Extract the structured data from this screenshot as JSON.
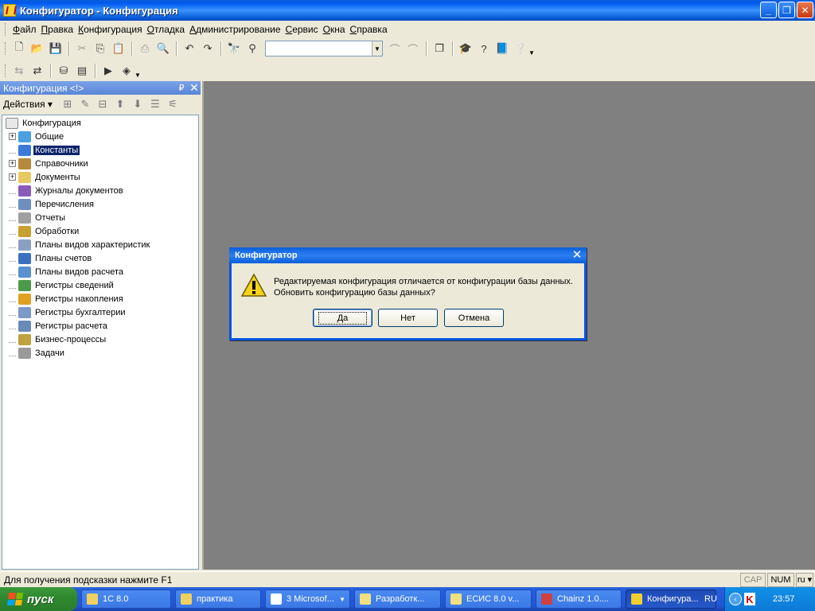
{
  "window": {
    "title": "Конфигуратор - Конфигурация",
    "min": "_",
    "restore": "❐",
    "close": "✕"
  },
  "menu": [
    {
      "u": "Ф",
      "rest": "айл"
    },
    {
      "u": "П",
      "rest": "равка"
    },
    {
      "u": "К",
      "rest": "онфигурация"
    },
    {
      "u": "О",
      "rest": "тладка"
    },
    {
      "u": "А",
      "rest": "дминистрирование"
    },
    {
      "u": "С",
      "rest": "ервис"
    },
    {
      "u": "О",
      "rest": "кна"
    },
    {
      "u": "С",
      "rest": "правка"
    }
  ],
  "search": {
    "value": ""
  },
  "panel": {
    "title": "Конфигурация <!>",
    "pin": "₽",
    "close": "✕",
    "actions": "Действия ▾",
    "tree": {
      "root": "Конфигурация",
      "items": [
        {
          "label": "Общие",
          "expander": "+",
          "color": "#4aa0e0"
        },
        {
          "label": "Константы",
          "expander": "",
          "color": "#3a7ad8",
          "selected": true
        },
        {
          "label": "Справочники",
          "expander": "+",
          "color": "#b58a3c"
        },
        {
          "label": "Документы",
          "expander": "+",
          "color": "#e8c860"
        },
        {
          "label": "Журналы документов",
          "expander": "",
          "color": "#8a5ab8"
        },
        {
          "label": "Перечисления",
          "expander": "",
          "color": "#6f8fc0"
        },
        {
          "label": "Отчеты",
          "expander": "",
          "color": "#a0a0a0"
        },
        {
          "label": "Обработки",
          "expander": "",
          "color": "#c8a030"
        },
        {
          "label": "Планы видов характеристик",
          "expander": "",
          "color": "#8aa0c0"
        },
        {
          "label": "Планы счетов",
          "expander": "",
          "color": "#3a70c0"
        },
        {
          "label": "Планы видов расчета",
          "expander": "",
          "color": "#5a90d0"
        },
        {
          "label": "Регистры сведений",
          "expander": "",
          "color": "#4a9a4a"
        },
        {
          "label": "Регистры накопления",
          "expander": "",
          "color": "#e0a020"
        },
        {
          "label": "Регистры бухгалтерии",
          "expander": "",
          "color": "#7a9ac8"
        },
        {
          "label": "Регистры расчета",
          "expander": "",
          "color": "#6a8ab8"
        },
        {
          "label": "Бизнес-процессы",
          "expander": "",
          "color": "#c0a040"
        },
        {
          "label": "Задачи",
          "expander": "",
          "color": "#9a9a9a"
        }
      ]
    }
  },
  "dialog": {
    "title": "Конфигуратор",
    "close": "✕",
    "message_line1": "Редактируемая конфигурация отличается от конфигурации базы данных.",
    "message_line2": "Обновить конфигурацию базы данных?",
    "yes": "Да",
    "no": "Нет",
    "cancel": "Отмена"
  },
  "status": {
    "hint": "Для получения подсказки нажмите F1",
    "cap": "CAP",
    "num": "NUM",
    "lang": "ru ▾"
  },
  "taskbar": {
    "start": "пуск",
    "tasks": [
      {
        "label": "1С 8.0",
        "color": "#f0d060"
      },
      {
        "label": "практика",
        "color": "#f0d060"
      },
      {
        "label": "3 Microsof...",
        "color": "#ffffff",
        "menu": true
      },
      {
        "label": "Разработк...",
        "color": "#f0e080"
      },
      {
        "label": "ЕСИС 8.0 v...",
        "color": "#f0e080"
      },
      {
        "label": "Chainz 1.0....",
        "color": "#d04040"
      },
      {
        "label": "Конфигура...",
        "color": "#f0d030",
        "active": true
      }
    ],
    "lang": "RU",
    "clock": "23:57"
  }
}
